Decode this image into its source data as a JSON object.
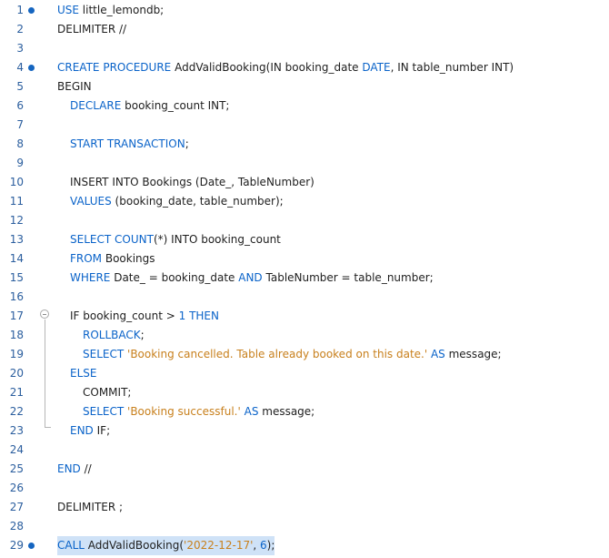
{
  "editor": {
    "colors": {
      "keyword": "#0a63c9",
      "string": "#c8801d",
      "line_number": "#2b5e9e",
      "breakpoint": "#1565c0",
      "selection": "#cfe2f7"
    },
    "lines": [
      {
        "num": "1",
        "marker": true,
        "indent": 0,
        "tokens": [
          {
            "t": "USE",
            "c": "kw"
          },
          {
            "t": " little_lemondb;",
            "c": ""
          }
        ]
      },
      {
        "num": "2",
        "marker": false,
        "indent": 0,
        "tokens": [
          {
            "t": "DELIMITER //",
            "c": ""
          }
        ]
      },
      {
        "num": "3",
        "marker": false,
        "indent": 0,
        "tokens": []
      },
      {
        "num": "4",
        "marker": true,
        "indent": 0,
        "tokens": [
          {
            "t": "CREATE",
            "c": "kw"
          },
          {
            "t": " ",
            "c": ""
          },
          {
            "t": "PROCEDURE",
            "c": "kw"
          },
          {
            "t": " AddValidBooking(IN booking_date ",
            "c": ""
          },
          {
            "t": "DATE",
            "c": "kw"
          },
          {
            "t": ", IN table_number INT)",
            "c": ""
          }
        ]
      },
      {
        "num": "5",
        "marker": false,
        "indent": 0,
        "tokens": [
          {
            "t": "BEGIN",
            "c": ""
          }
        ]
      },
      {
        "num": "6",
        "marker": false,
        "indent": 1,
        "tokens": [
          {
            "t": "DECLARE",
            "c": "kw"
          },
          {
            "t": " booking_count INT;",
            "c": ""
          }
        ]
      },
      {
        "num": "7",
        "marker": false,
        "indent": 0,
        "tokens": []
      },
      {
        "num": "8",
        "marker": false,
        "indent": 1,
        "tokens": [
          {
            "t": "START TRANSACTION",
            "c": "kw"
          },
          {
            "t": ";",
            "c": ""
          }
        ]
      },
      {
        "num": "9",
        "marker": false,
        "indent": 0,
        "tokens": []
      },
      {
        "num": "10",
        "marker": false,
        "indent": 1,
        "tokens": [
          {
            "t": "INSERT INTO Bookings (Date_, TableNumber)",
            "c": ""
          }
        ]
      },
      {
        "num": "11",
        "marker": false,
        "indent": 1,
        "tokens": [
          {
            "t": "VALUES",
            "c": "kw"
          },
          {
            "t": " (booking_date, table_number);",
            "c": ""
          }
        ]
      },
      {
        "num": "12",
        "marker": false,
        "indent": 0,
        "tokens": []
      },
      {
        "num": "13",
        "marker": false,
        "indent": 1,
        "tokens": [
          {
            "t": "SELECT",
            "c": "kw"
          },
          {
            "t": " ",
            "c": ""
          },
          {
            "t": "COUNT",
            "c": "fn"
          },
          {
            "t": "(*) INTO booking_count",
            "c": ""
          }
        ]
      },
      {
        "num": "14",
        "marker": false,
        "indent": 1,
        "tokens": [
          {
            "t": "FROM",
            "c": "kw"
          },
          {
            "t": " Bookings",
            "c": ""
          }
        ]
      },
      {
        "num": "15",
        "marker": false,
        "indent": 1,
        "tokens": [
          {
            "t": "WHERE",
            "c": "kw"
          },
          {
            "t": " Date_ = booking_date ",
            "c": ""
          },
          {
            "t": "AND",
            "c": "kw"
          },
          {
            "t": " TableNumber = table_number;",
            "c": ""
          }
        ]
      },
      {
        "num": "16",
        "marker": false,
        "indent": 0,
        "tokens": []
      },
      {
        "num": "17",
        "marker": false,
        "indent": 1,
        "tokens": [
          {
            "t": "IF booking_count > ",
            "c": ""
          },
          {
            "t": "1",
            "c": "num"
          },
          {
            "t": " ",
            "c": ""
          },
          {
            "t": "THEN",
            "c": "kw"
          }
        ]
      },
      {
        "num": "18",
        "marker": false,
        "indent": 2,
        "tokens": [
          {
            "t": "ROLLBACK",
            "c": "kw"
          },
          {
            "t": ";",
            "c": ""
          }
        ]
      },
      {
        "num": "19",
        "marker": false,
        "indent": 2,
        "tokens": [
          {
            "t": "SELECT",
            "c": "kw"
          },
          {
            "t": " ",
            "c": ""
          },
          {
            "t": "'Booking cancelled. Table already booked on this date.'",
            "c": "str"
          },
          {
            "t": " ",
            "c": ""
          },
          {
            "t": "AS",
            "c": "kw"
          },
          {
            "t": " message;",
            "c": ""
          }
        ]
      },
      {
        "num": "20",
        "marker": false,
        "indent": 1,
        "tokens": [
          {
            "t": "ELSE",
            "c": "kw"
          }
        ]
      },
      {
        "num": "21",
        "marker": false,
        "indent": 2,
        "tokens": [
          {
            "t": "COMMIT;",
            "c": ""
          }
        ]
      },
      {
        "num": "22",
        "marker": false,
        "indent": 2,
        "tokens": [
          {
            "t": "SELECT",
            "c": "kw"
          },
          {
            "t": " ",
            "c": ""
          },
          {
            "t": "'Booking successful.'",
            "c": "str"
          },
          {
            "t": " ",
            "c": ""
          },
          {
            "t": "AS",
            "c": "kw"
          },
          {
            "t": " message;",
            "c": ""
          }
        ]
      },
      {
        "num": "23",
        "marker": false,
        "indent": 1,
        "tokens": [
          {
            "t": "END",
            "c": "kw"
          },
          {
            "t": " IF;",
            "c": ""
          }
        ]
      },
      {
        "num": "24",
        "marker": false,
        "indent": 0,
        "tokens": []
      },
      {
        "num": "25",
        "marker": false,
        "indent": 0,
        "tokens": [
          {
            "t": "END",
            "c": "kw"
          },
          {
            "t": " //",
            "c": ""
          }
        ]
      },
      {
        "num": "26",
        "marker": false,
        "indent": 0,
        "tokens": []
      },
      {
        "num": "27",
        "marker": false,
        "indent": 0,
        "tokens": [
          {
            "t": "DELIMITER ;",
            "c": ""
          }
        ]
      },
      {
        "num": "28",
        "marker": false,
        "indent": 0,
        "tokens": []
      },
      {
        "num": "29",
        "marker": true,
        "indent": 0,
        "highlight": true,
        "tokens": [
          {
            "t": "CALL",
            "c": "kw"
          },
          {
            "t": " AddValidBooking(",
            "c": ""
          },
          {
            "t": "'2022-12-17'",
            "c": "str"
          },
          {
            "t": ", ",
            "c": ""
          },
          {
            "t": "6",
            "c": "num"
          },
          {
            "t": ");",
            "c": ""
          }
        ]
      }
    ]
  }
}
